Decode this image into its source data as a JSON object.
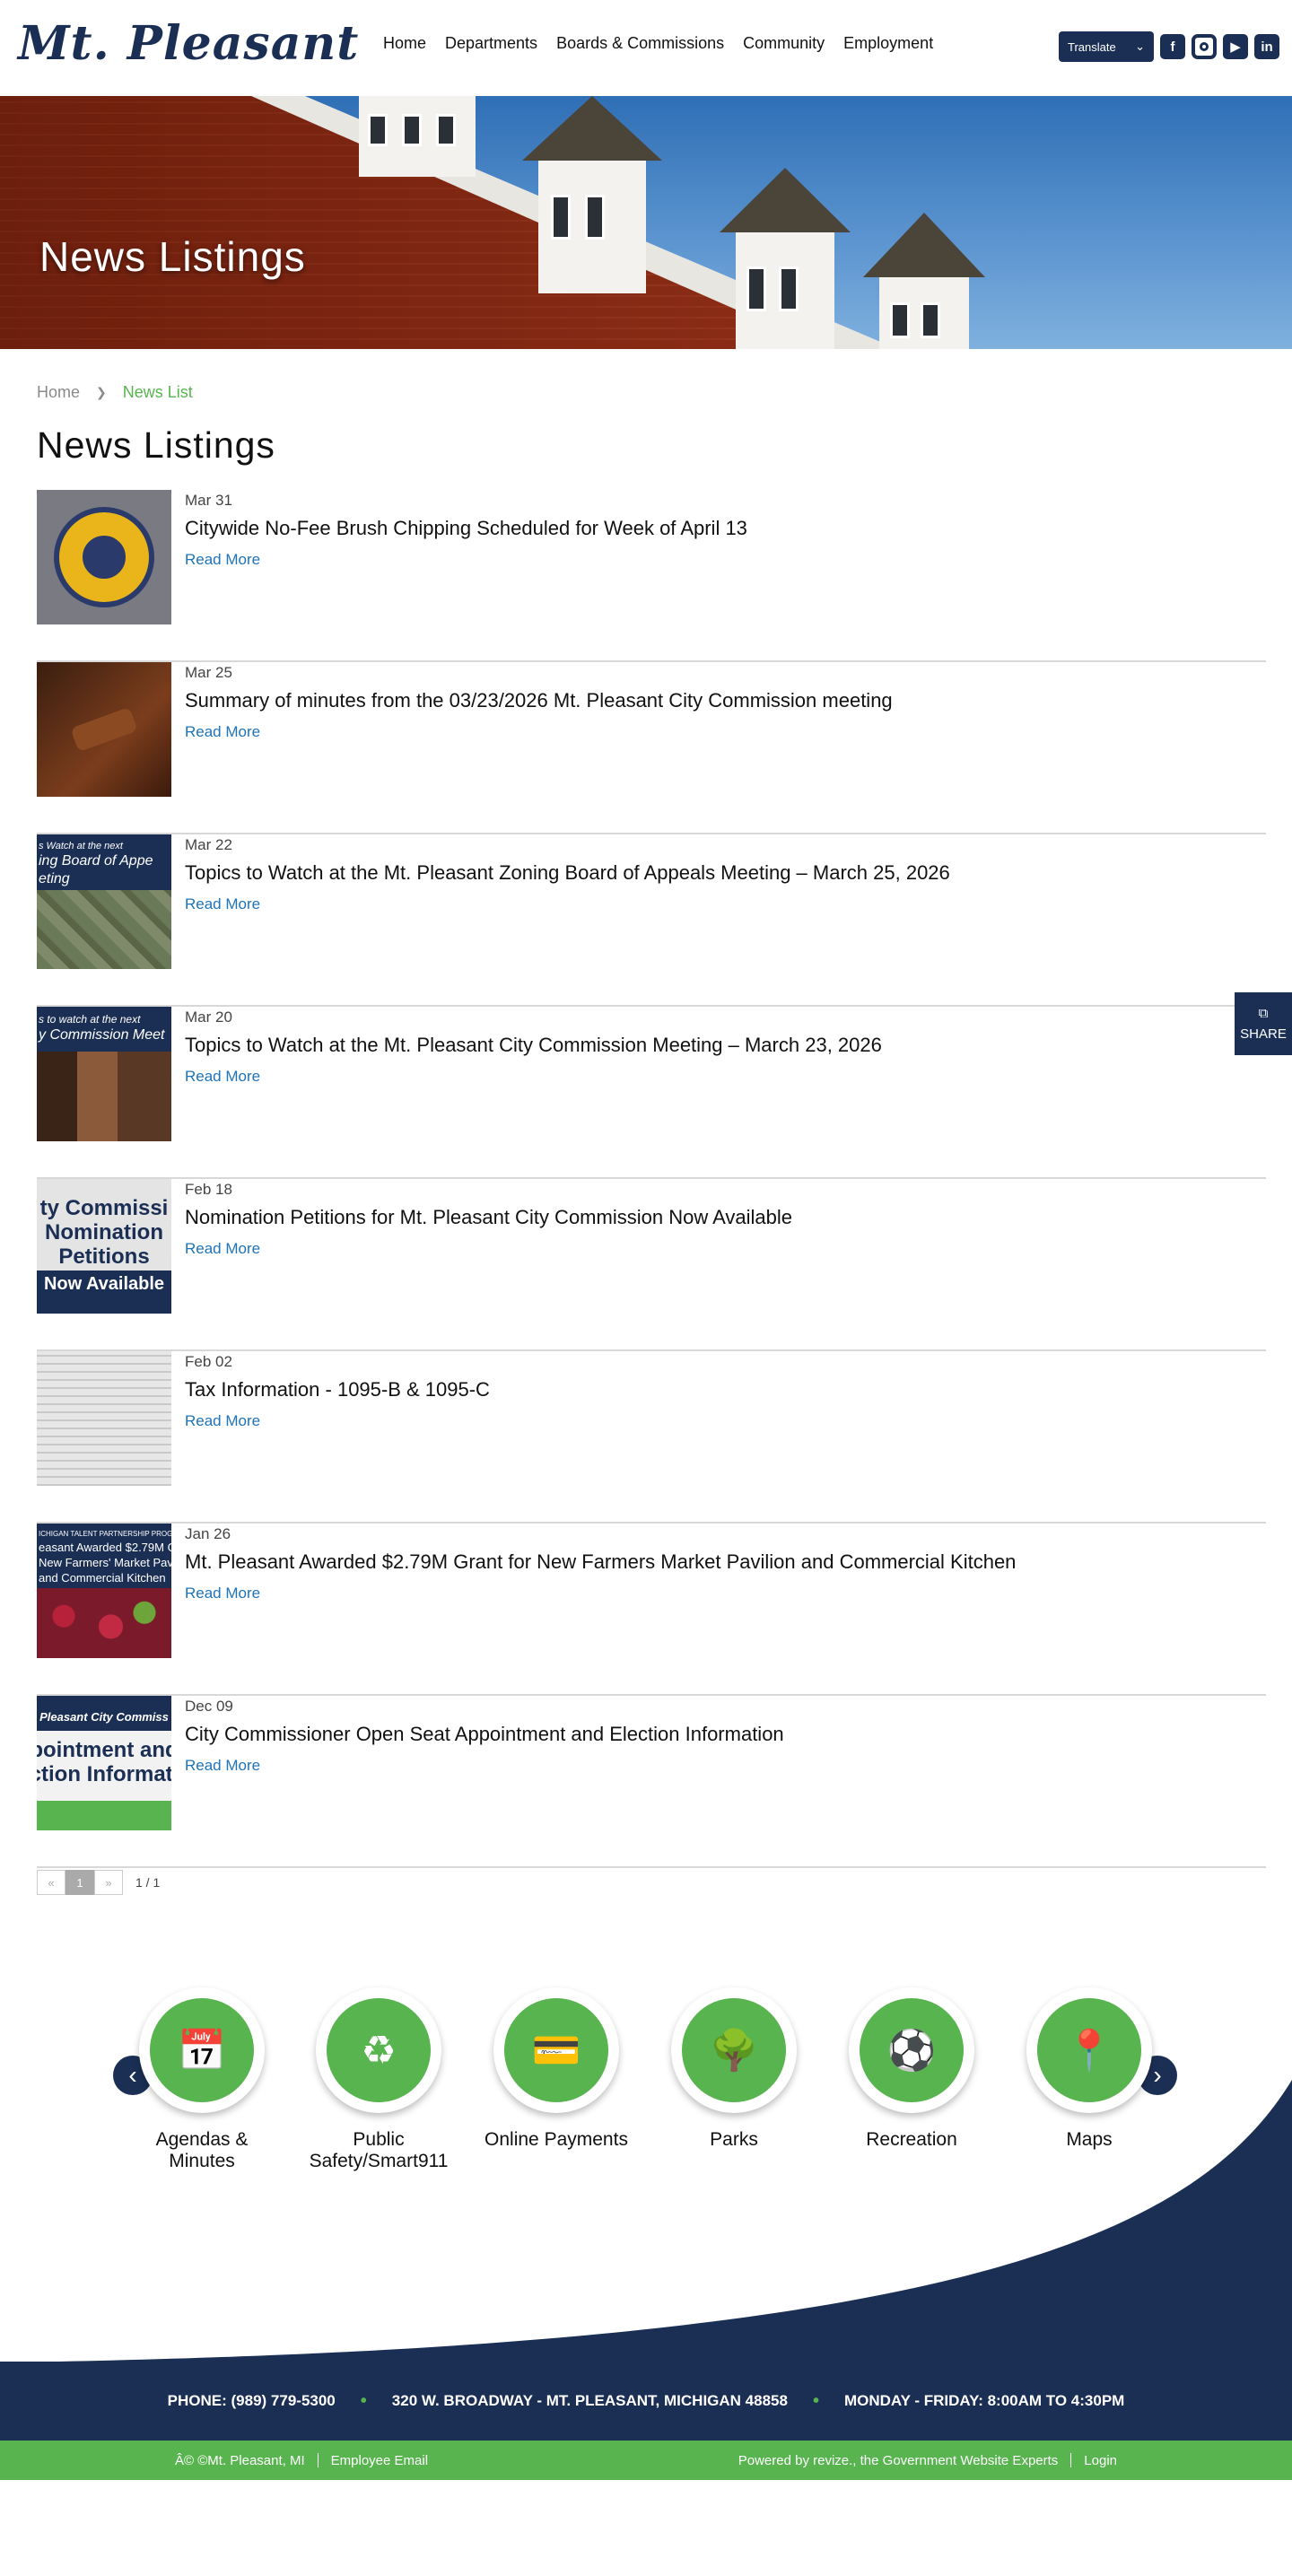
{
  "header": {
    "logo": "Mt. Pleasant",
    "nav": [
      "Home",
      "Departments",
      "Boards & Commissions",
      "Community",
      "Employment"
    ],
    "translate_label": "Translate",
    "social": [
      "facebook-icon",
      "instagram-icon",
      "youtube-icon",
      "linkedin-icon"
    ]
  },
  "banner": {
    "title": "News Listings"
  },
  "breadcrumb": {
    "home": "Home",
    "current": "News List"
  },
  "page_title": "News Listings",
  "news": [
    {
      "date": "Mar 31",
      "title": "Citywide No-Fee Brush Chipping Scheduled for Week of April 13",
      "read_more": "Read More",
      "thumb": "city-seal"
    },
    {
      "date": "Mar 25",
      "title": "Summary of minutes from the 03/23/2026 Mt. Pleasant City Commission meeting",
      "read_more": "Read More",
      "thumb": "gavel"
    },
    {
      "date": "Mar 22",
      "title": "Topics to Watch at the Mt. Pleasant Zoning Board of Appeals Meeting – March 25, 2026",
      "read_more": "Read More",
      "thumb": "zoning",
      "thumb_text": [
        "s Watch at the next",
        "ing Board of Appe",
        "eting"
      ]
    },
    {
      "date": "Mar 20",
      "title": "Topics to Watch at the Mt. Pleasant City Commission Meeting – March 23, 2026",
      "read_more": "Read More",
      "thumb": "commission",
      "thumb_text": [
        "s to watch at the next",
        "y Commission Meet"
      ]
    },
    {
      "date": "Feb 18",
      "title": "Nomination Petitions for Mt. Pleasant City Commission Now Available",
      "read_more": "Read More",
      "thumb": "petition",
      "thumb_text": [
        "ty Commissi",
        "Nomination",
        "Petitions",
        "Now Available"
      ]
    },
    {
      "date": "Feb 02",
      "title": "Tax Information - 1095-B & 1095-C",
      "read_more": "Read More",
      "thumb": "tax"
    },
    {
      "date": "Jan 26",
      "title": "Mt. Pleasant Awarded $2.79M Grant for New Farmers Market Pavilion and Commercial Kitchen",
      "read_more": "Read More",
      "thumb": "grant",
      "thumb_text": [
        "ICHIGAN TALENT PARTNERSHIP PROGRA",
        "easant Awarded $2.79M G",
        "New Farmers' Market Pav",
        "and Commercial Kitchen"
      ]
    },
    {
      "date": "Dec 09",
      "title": "City Commissioner Open Seat Appointment and Election Information",
      "read_more": "Read More",
      "thumb": "appointment",
      "thumb_text": [
        "Pleasant City Commiss",
        "pointment and",
        "ction Informati"
      ]
    }
  ],
  "pagination": {
    "prev": "«",
    "page": "1",
    "next": "»",
    "count": "1 / 1"
  },
  "quick_links": [
    {
      "label": "Agendas & Minutes",
      "icon": "calendar-icon"
    },
    {
      "label": "Public Safety/Smart911",
      "icon": "safety-icon"
    },
    {
      "label": "Online Payments",
      "icon": "payment-icon"
    },
    {
      "label": "Parks",
      "icon": "park-icon"
    },
    {
      "label": "Recreation",
      "icon": "recreation-icon"
    },
    {
      "label": "Maps",
      "icon": "map-pin-icon"
    }
  ],
  "footer": {
    "phone": "PHONE: (989) 779-5300",
    "address": "320 W. BROADWAY - MT. PLEASANT, MICHIGAN 48858",
    "hours": "MONDAY - FRIDAY: 8:00AM TO 4:30PM",
    "copyright": "Â© ©Mt. Pleasant, MI",
    "employee_email": "Employee Email",
    "powered_by": "Powered by revize., the Government Website Experts",
    "login": "Login"
  },
  "share": {
    "label": "SHARE"
  },
  "colors": {
    "navy": "#1b2f55",
    "green": "#58b44f",
    "link": "#1d74b8"
  }
}
